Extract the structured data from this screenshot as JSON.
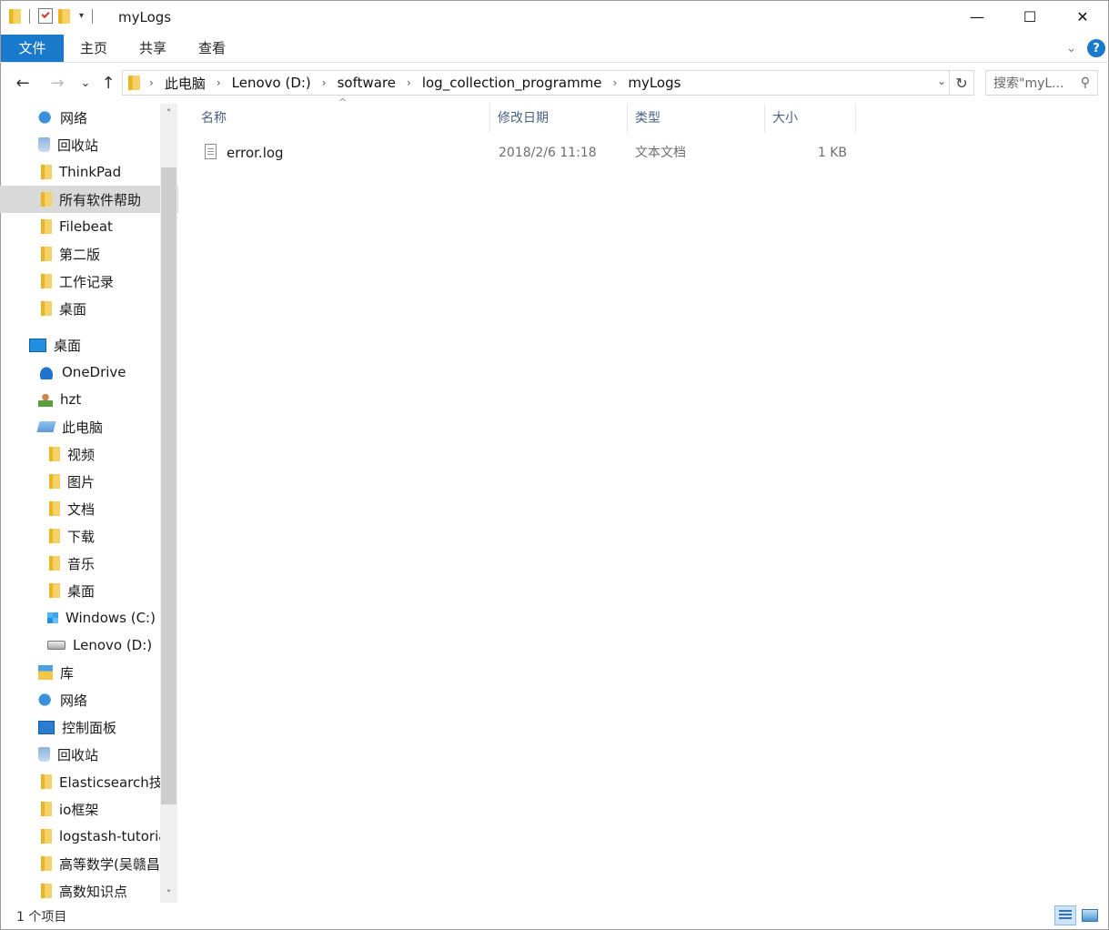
{
  "window": {
    "title": "myLogs"
  },
  "window_controls": {
    "minimize": "—",
    "maximize": "☐",
    "close": "✕"
  },
  "qat": {
    "dropdown": "▾"
  },
  "ribbon": {
    "tabs": [
      "文件",
      "主页",
      "共享",
      "查看"
    ],
    "expand": "⌄",
    "help": "?"
  },
  "nav": {
    "back": "←",
    "forward": "→",
    "recent": "⌄",
    "up": "↑"
  },
  "address": {
    "crumbs": [
      "此电脑",
      "Lenovo (D:)",
      "software",
      "log_collection_programme",
      "myLogs"
    ],
    "dropdown": "⌄",
    "refresh": "↻"
  },
  "search": {
    "placeholder": "搜索\"myL...",
    "icon": "⚲"
  },
  "navpane": {
    "items": [
      {
        "label": "网络",
        "icon": "network-icon",
        "pinned": true
      },
      {
        "label": "回收站",
        "icon": "recycle-bin-icon",
        "pinned": true
      },
      {
        "label": "ThinkPad",
        "icon": "folder-icon",
        "pinned": true
      },
      {
        "label": "所有软件帮助",
        "icon": "folder-icon",
        "pinned": true,
        "selected": true
      },
      {
        "label": "Filebeat",
        "icon": "folder-icon"
      },
      {
        "label": "第二版",
        "icon": "folder-icon"
      },
      {
        "label": "工作记录",
        "icon": "folder-icon"
      },
      {
        "label": "桌面",
        "icon": "desktop-folder-icon"
      },
      {
        "label": "桌面",
        "icon": "desktop-icon",
        "indent": 1
      },
      {
        "label": "OneDrive",
        "icon": "onedrive-icon",
        "indent": 2
      },
      {
        "label": "hzt",
        "icon": "user-folder-icon",
        "indent": 2
      },
      {
        "label": "此电脑",
        "icon": "this-pc-icon",
        "indent": 2
      },
      {
        "label": "视频",
        "icon": "videos-folder-icon",
        "indent": 3
      },
      {
        "label": "图片",
        "icon": "pictures-folder-icon",
        "indent": 3
      },
      {
        "label": "文档",
        "icon": "documents-folder-icon",
        "indent": 3
      },
      {
        "label": "下载",
        "icon": "downloads-folder-icon",
        "indent": 3
      },
      {
        "label": "音乐",
        "icon": "music-folder-icon",
        "indent": 3
      },
      {
        "label": "桌面",
        "icon": "desktop-folder-icon",
        "indent": 3
      },
      {
        "label": "Windows (C:)",
        "icon": "windows-drive-icon",
        "indent": 3
      },
      {
        "label": "Lenovo (D:)",
        "icon": "drive-icon",
        "indent": 3
      },
      {
        "label": "库",
        "icon": "libraries-icon",
        "indent": 2
      },
      {
        "label": "网络",
        "icon": "network-icon",
        "indent": 2
      },
      {
        "label": "控制面板",
        "icon": "control-panel-icon",
        "indent": 2
      },
      {
        "label": "回收站",
        "icon": "recycle-bin-icon",
        "indent": 2
      },
      {
        "label": "Elasticsearch技术",
        "icon": "folder-icon",
        "indent": 2
      },
      {
        "label": "io框架",
        "icon": "folder-icon",
        "indent": 2
      },
      {
        "label": "logstash-tutorial",
        "icon": "folder-icon",
        "indent": 2
      },
      {
        "label": "高等数学(吴赣昌",
        "icon": "folder-icon",
        "indent": 2
      },
      {
        "label": "高数知识点",
        "icon": "folder-icon",
        "indent": 2
      }
    ],
    "pin_glyph": "📌",
    "scroll_up": "˄",
    "scroll_down": "˅"
  },
  "filelist": {
    "columns": [
      "名称",
      "修改日期",
      "类型",
      "大小"
    ],
    "sort_caret": "^",
    "rows": [
      {
        "name": "error.log",
        "modified": "2018/2/6 11:18",
        "type": "文本文档",
        "size": "1 KB"
      }
    ]
  },
  "status": {
    "count": "1 个项目"
  }
}
